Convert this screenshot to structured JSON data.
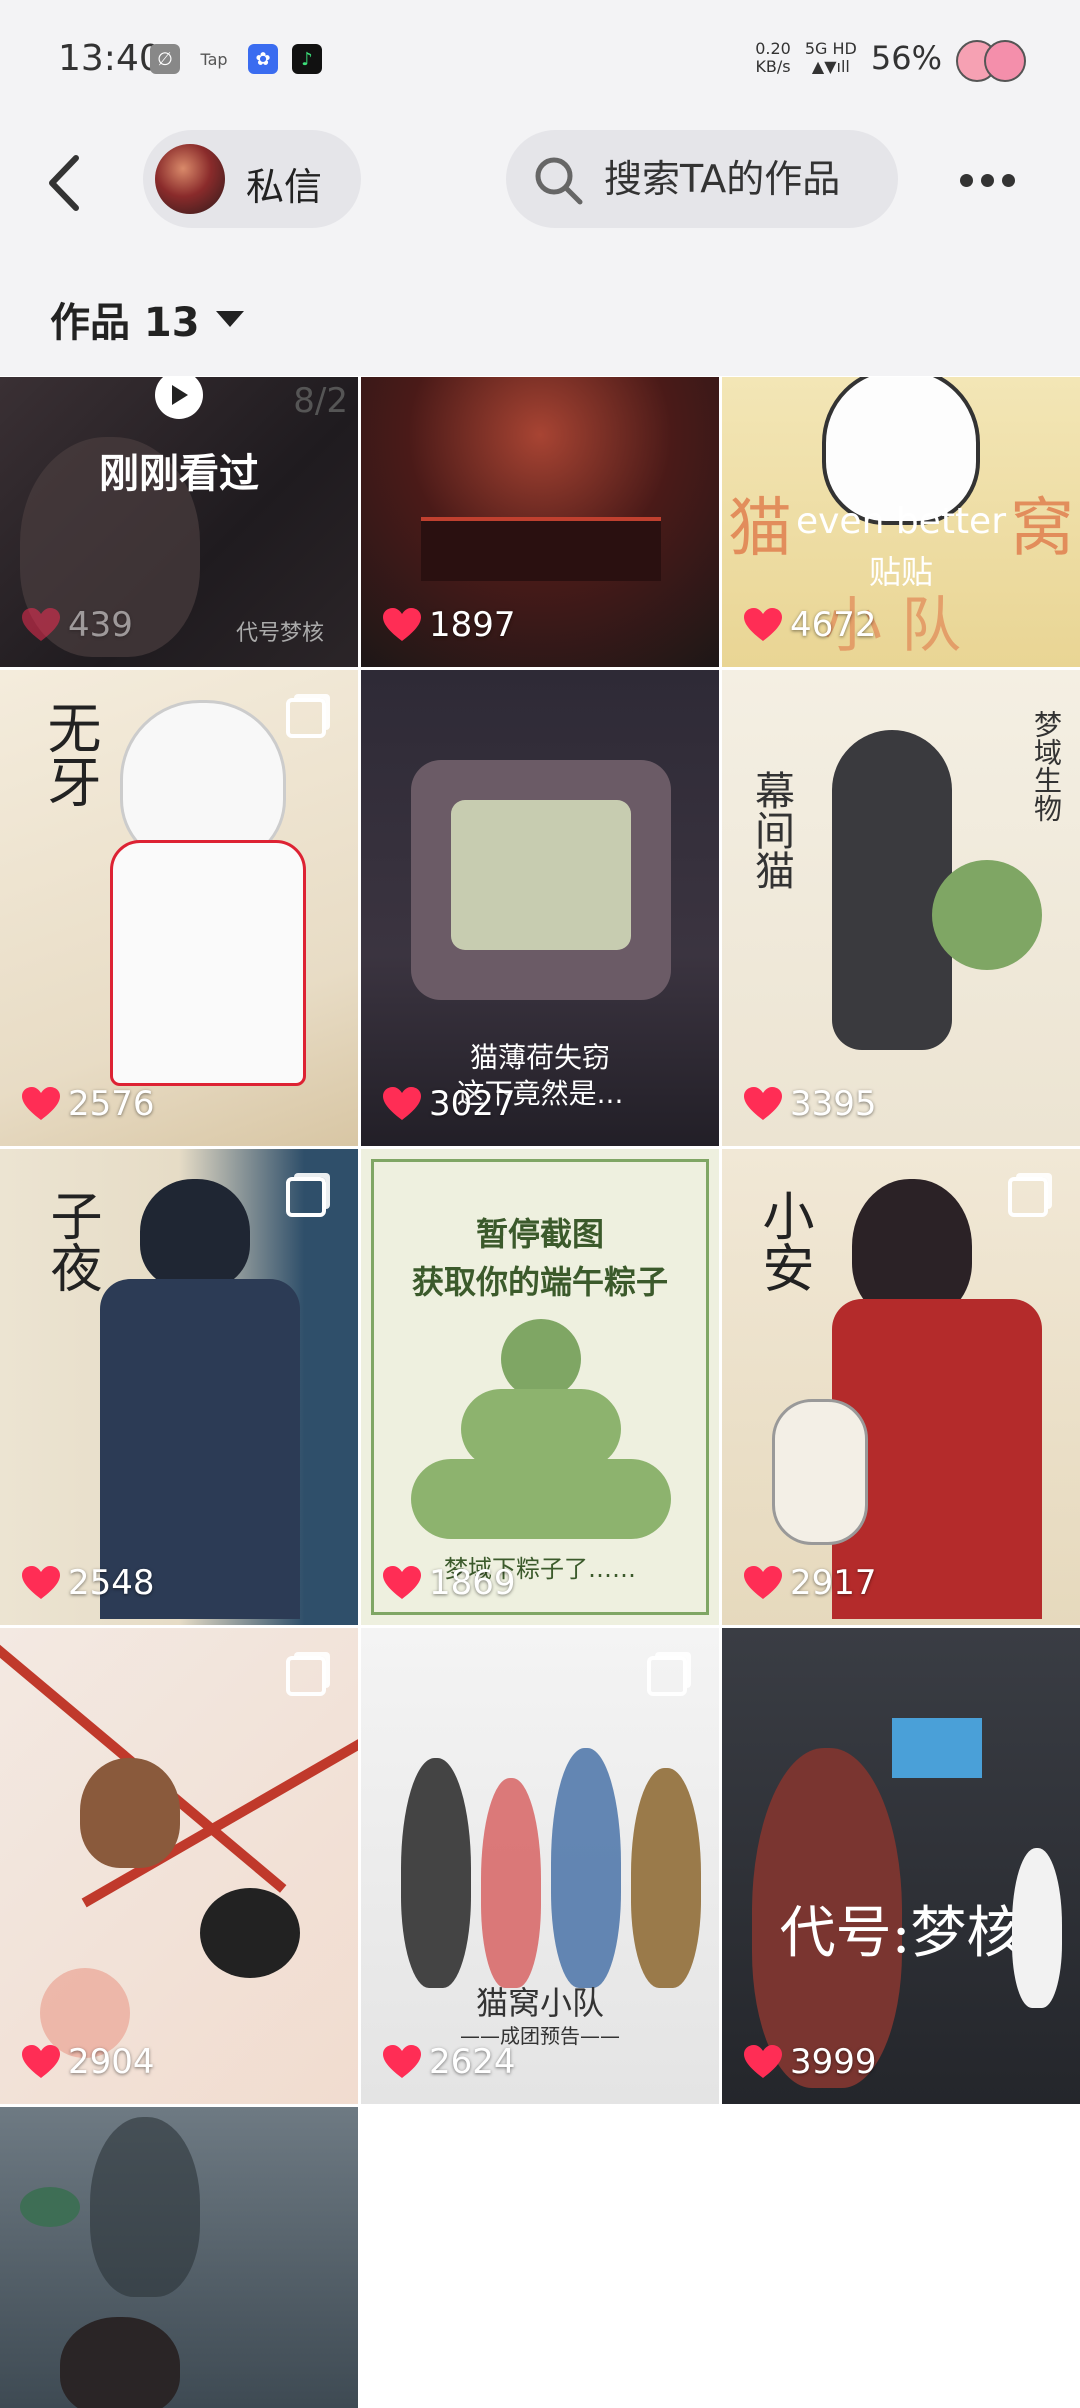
{
  "status": {
    "time": "13:40",
    "tap": "Tap",
    "net_speed": "0.20",
    "net_unit": "KB/s",
    "net_type": "5G HD",
    "battery": "56%"
  },
  "header": {
    "dm_label": "私信",
    "search_placeholder": "搜索TA的作品"
  },
  "tab": {
    "works_label": "作品 13"
  },
  "tiles": [
    {
      "likes": "439",
      "title": "刚刚看过",
      "date": "8/2",
      "watermark": "代号梦核"
    },
    {
      "likes": "1897"
    },
    {
      "likes": "4672",
      "title_line1": "even better",
      "title_line2": "贴贴",
      "bg_text1": "猫",
      "bg_text2": "窝",
      "bg_text3": "小 队"
    },
    {
      "likes": "2576",
      "name": "无牙"
    },
    {
      "likes": "3027",
      "caption": "猫薄荷失窃\n这下竟然是..."
    },
    {
      "likes": "3395",
      "name": "幕间猫",
      "side": "梦域生物"
    },
    {
      "likes": "2548",
      "name": "子夜"
    },
    {
      "likes": "1869",
      "line1": "暂停截图",
      "line2": "获取你的端午粽子",
      "bottom": "梦域下粽子了……"
    },
    {
      "likes": "2917",
      "name": "小安"
    },
    {
      "likes": "2904"
    },
    {
      "likes": "2624",
      "title": "猫窝小队",
      "subtitle": "——成团预告——"
    },
    {
      "likes": "3999",
      "title": "代号:梦核"
    },
    {
      "likes": ""
    }
  ],
  "colors": {
    "heart": "#ff2d55",
    "bg": "#f3f3f5"
  }
}
